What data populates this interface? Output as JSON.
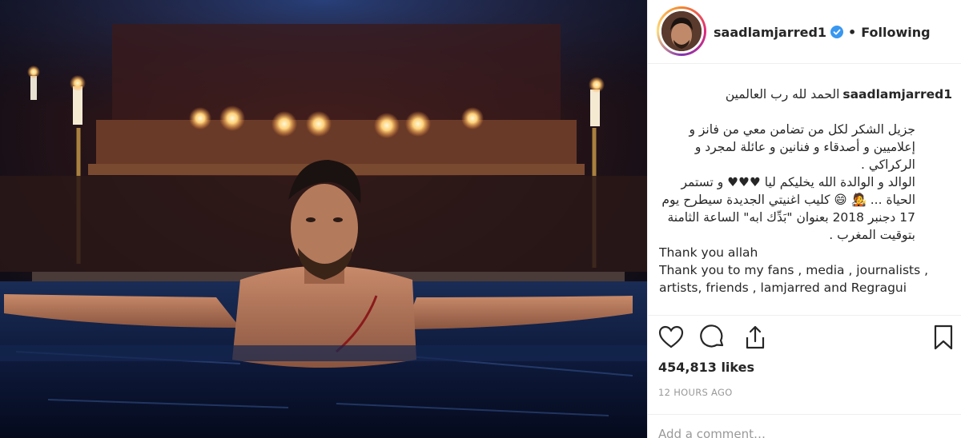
{
  "post": {
    "username": "saadlamjarred1",
    "separator": "•",
    "follow_status": "Following",
    "caption": {
      "first_line": "الحمد لله رب العالمين",
      "arabic_paragraph_1": "جزيل الشكر لكل من تضامن معي من فانز و إعلاميين و أصدقاء و فنانين و عائلة لمجرد و الركراكي .",
      "arabic_paragraph_2": "الوالد و الوالدة الله يخليكم ليا ♥♥♥ و تستمر الحياة ... 🧑‍🎤 😄 كليب اغنيتي الجديدة سيطرح يوم 17 دجنبر 2018 بعنوان \"بَدِّك ابه\" الساعة الثامنة بتوقيت المغرب .",
      "english_line_1": "Thank you allah",
      "english_line_2": "Thank you to my fans , media , journalists , artists, friends , lamjarred and Regragui"
    },
    "likes": "454,813 likes",
    "time_ago": "12 HOURS AGO",
    "comment_placeholder": "Add a comment…"
  },
  "icons": {
    "verified": "verified-badge-icon",
    "like": "heart-icon",
    "comment": "comment-bubble-icon",
    "share": "share-icon",
    "save": "bookmark-icon"
  },
  "colors": {
    "verified_blue": "#3897f0",
    "text": "#262626",
    "muted": "#999999",
    "divider": "#efefef"
  }
}
